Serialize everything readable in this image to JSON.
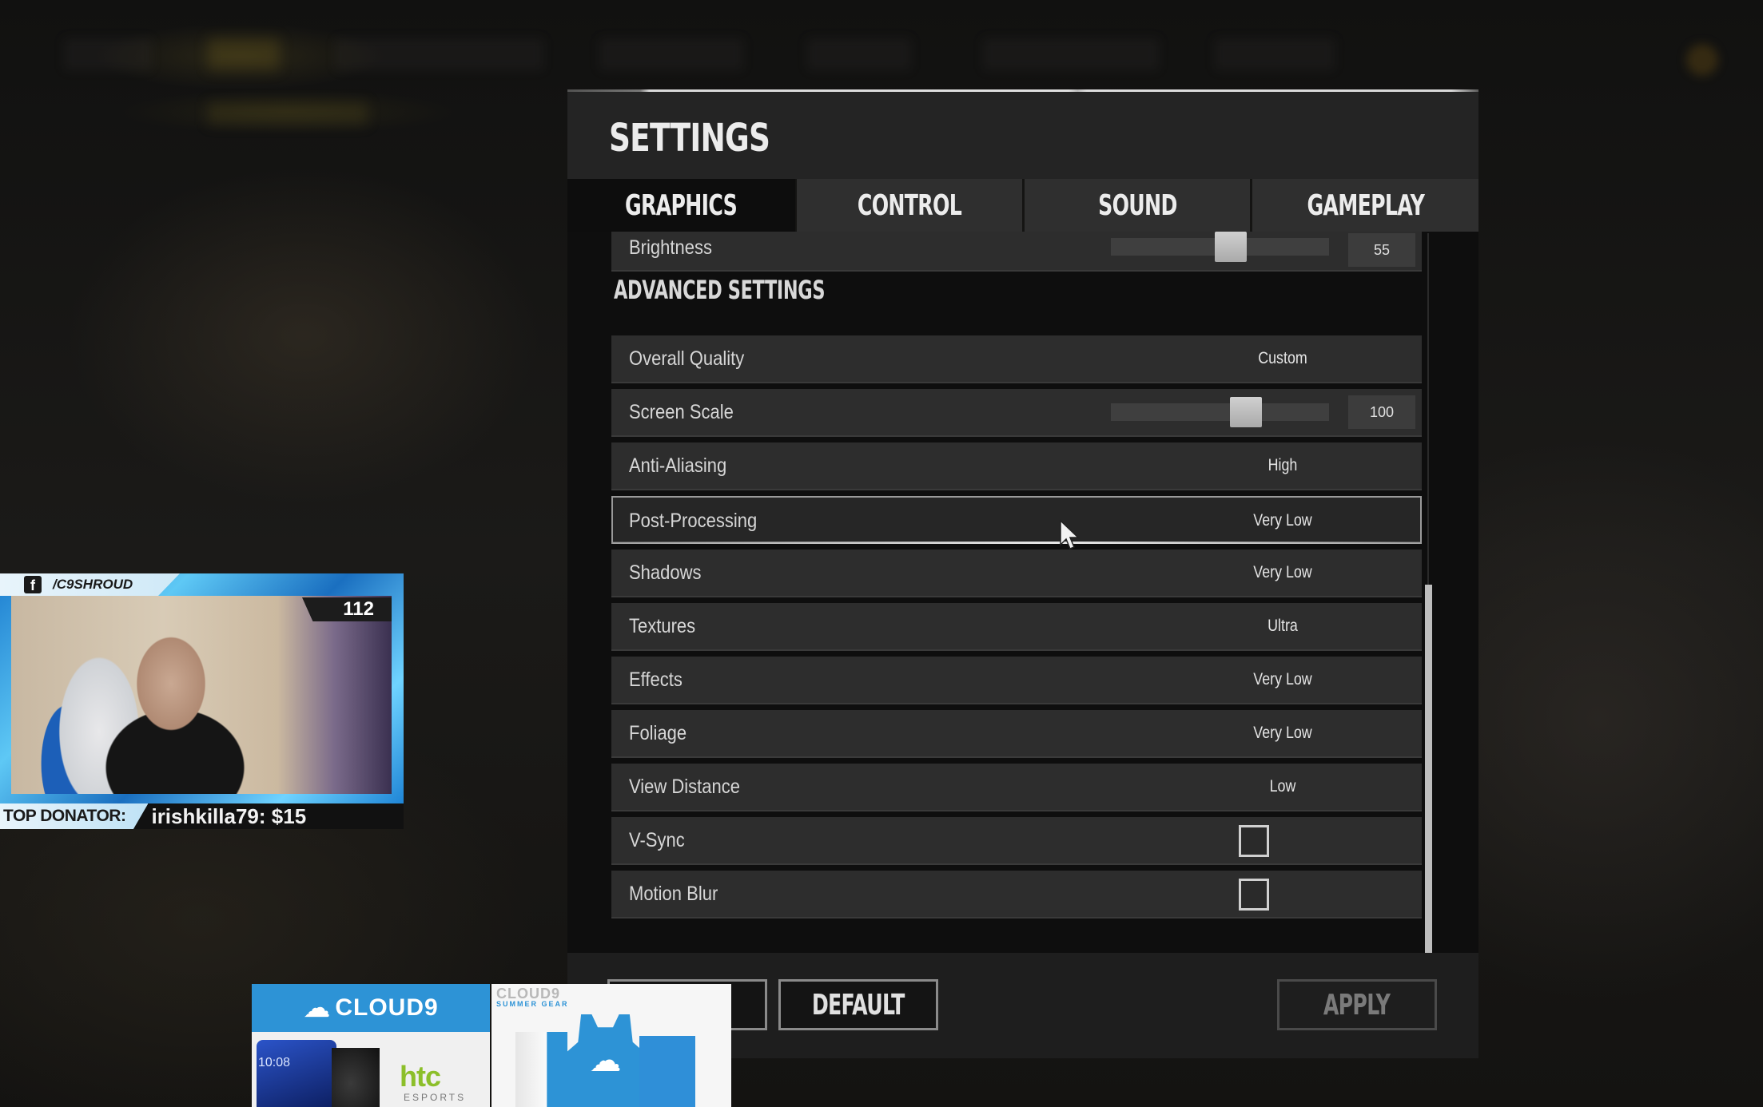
{
  "settings": {
    "title": "SETTINGS",
    "tabs": [
      {
        "label": "GRAPHICS",
        "active": true
      },
      {
        "label": "CONTROL",
        "active": false
      },
      {
        "label": "SOUND",
        "active": false
      },
      {
        "label": "GAMEPLAY",
        "active": false
      }
    ],
    "brightness": {
      "label": "Brightness",
      "value": "55",
      "fraction": 0.55
    },
    "advanced_header": "ADVANCED SETTINGS",
    "rows": [
      {
        "label": "Overall Quality",
        "value": "Custom"
      },
      {
        "label": "Screen Scale",
        "value": "100",
        "type": "slider",
        "fraction": 0.62
      },
      {
        "label": "Anti-Aliasing",
        "value": "High"
      },
      {
        "label": "Post-Processing",
        "value": "Very Low",
        "highlighted": true
      },
      {
        "label": "Shadows",
        "value": "Very Low"
      },
      {
        "label": "Textures",
        "value": "Ultra"
      },
      {
        "label": "Effects",
        "value": "Very Low"
      },
      {
        "label": "Foliage",
        "value": "Very Low"
      },
      {
        "label": "View Distance",
        "value": "Low"
      },
      {
        "label": "V-Sync",
        "type": "checkbox",
        "checked": false
      },
      {
        "label": "Motion Blur",
        "type": "checkbox",
        "checked": false
      }
    ],
    "buttons": {
      "default_label": "DEFAULT",
      "apply_label": "APPLY",
      "apply_enabled": false
    }
  },
  "stream_overlay": {
    "social_icon": "facebook-icon",
    "handle": "/C9SHROUD",
    "viewer_count": "112",
    "top_donator_label": "TOP DONATOR:",
    "top_donator_value": "irishkilla79: $15"
  },
  "ad_banner": {
    "brand": "CLOUD9",
    "brand_icon": "☁",
    "sponsor": "htc",
    "sponsor_sub": "ESPORTS",
    "phone_time": "10:08",
    "gear_title": "CLOUD9",
    "gear_subtitle": "SUMMER GEAR",
    "accent_color": "#2d93d6"
  },
  "colors": {
    "panel_bg": "#242424",
    "row_bg": "#2d2d2d",
    "content_bg": "#0e0e0e",
    "text": "#d6d6d6",
    "cam_frame_blue": "#1e7fd0"
  }
}
